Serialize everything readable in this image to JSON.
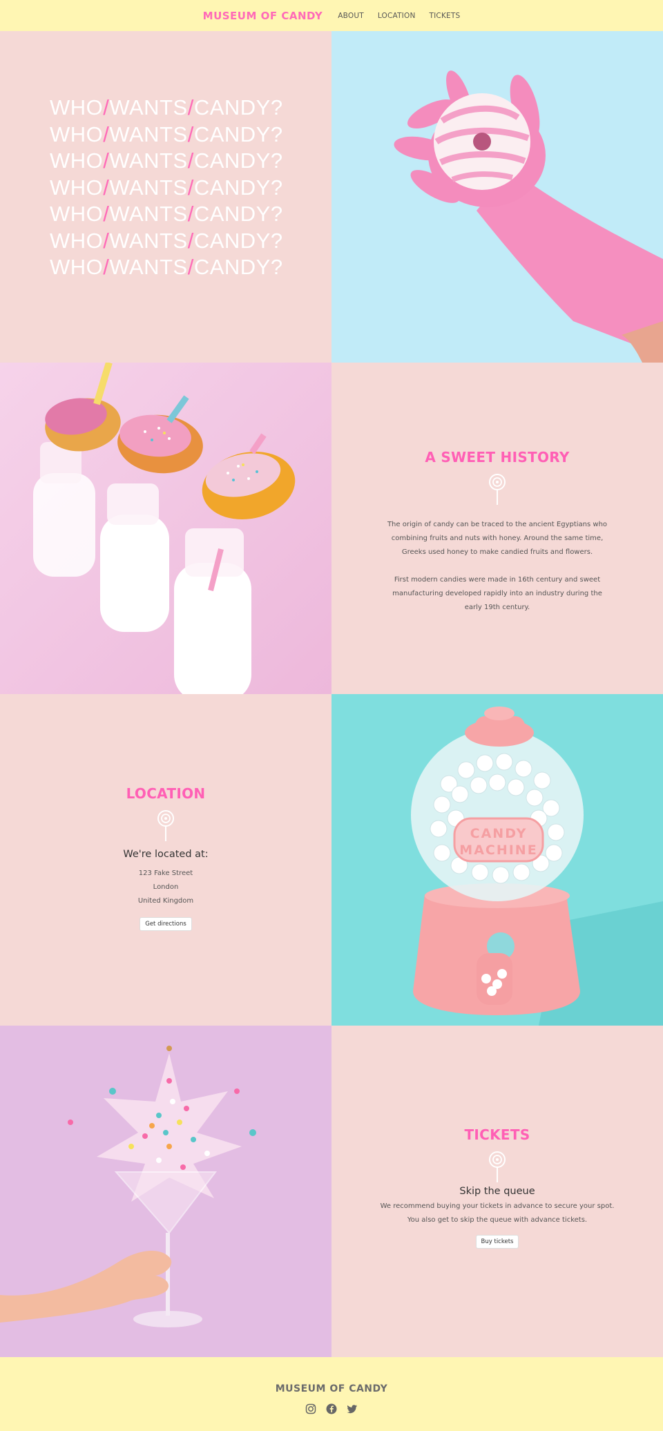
{
  "header": {
    "logo": "MUSEUM OF CANDY",
    "nav": [
      "ABOUT",
      "LOCATION",
      "TICKETS"
    ]
  },
  "hero": {
    "lines": [
      [
        "WHO",
        "/",
        "WANTS",
        "/",
        "CANDY?"
      ],
      [
        "WHO",
        "/",
        "WANTS",
        "/",
        "CANDY?"
      ],
      [
        "WHO",
        "/",
        "WANTS",
        "/",
        "CANDY?"
      ],
      [
        "WHO",
        "/",
        "WANTS",
        "/",
        "CANDY?"
      ],
      [
        "WHO",
        "/",
        "WANTS",
        "/",
        "CANDY?"
      ],
      [
        "WHO",
        "/",
        "WANTS",
        "/",
        "CANDY?"
      ],
      [
        "WHO",
        "/",
        "WANTS",
        "/",
        "CANDY?"
      ]
    ]
  },
  "history": {
    "title": "A SWEET HISTORY",
    "para1": "The origin of candy can be traced to the ancient Egyptians who combining fruits and nuts with honey. Around the same time, Greeks used honey to make candied fruits and flowers.",
    "para2": "First modern candies were made in 16th century and sweet manufacturing developed rapidly into an industry during the early 19th century."
  },
  "location": {
    "title": "LOCATION",
    "subhead": "We're located at:",
    "address": [
      "123 Fake Street",
      "London",
      "United Kingdom"
    ],
    "button": "Get directions"
  },
  "gumball": {
    "label_line1": "CANDY",
    "label_line2": "MACHINE"
  },
  "tickets": {
    "title": "TICKETS",
    "subhead": "Skip the queue",
    "line1": "We recommend buying your tickets in advance to secure your spot.",
    "line2": "You also get to skip the queue with advance tickets.",
    "button": "Buy tickets"
  },
  "footer": {
    "logo": "MUSEUM OF CANDY",
    "social": [
      "instagram-icon",
      "facebook-icon",
      "twitter-icon"
    ]
  },
  "colors": {
    "accent": "#ff6ab8",
    "banner": "#fff6b3",
    "panel": "#f5d9d6"
  }
}
